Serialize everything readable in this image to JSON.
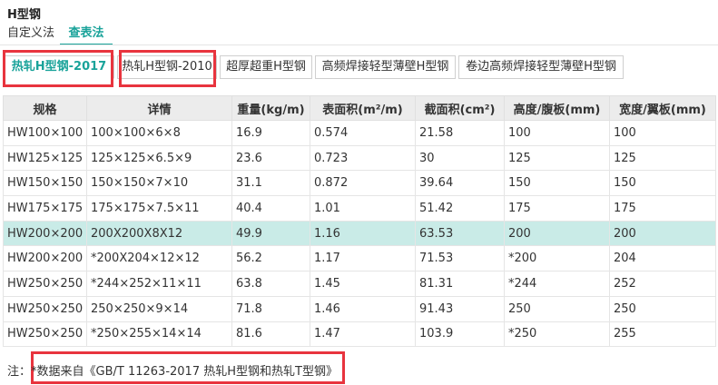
{
  "title": "H型钢",
  "mode_tabs": {
    "custom": "自定义法",
    "lookup": "查表法"
  },
  "standard_tabs": [
    "热轧H型钢-2017",
    "热轧H型钢-2010",
    "超厚超重H型钢",
    "高频焊接轻型薄壁H型钢",
    "卷边高频焊接轻型薄壁H型钢"
  ],
  "table": {
    "headers": [
      "规格",
      "详情",
      "重量(kg/m)",
      "表面积(m²/m)",
      "截面积(cm²)",
      "高度/腹板(mm)",
      "宽度/翼板(mm)"
    ],
    "rows": [
      [
        "HW100×100",
        "100×100×6×8",
        "16.9",
        "0.574",
        "21.58",
        "100",
        "100"
      ],
      [
        "HW125×125",
        "125×125×6.5×9",
        "23.6",
        "0.723",
        "30",
        "125",
        "125"
      ],
      [
        "HW150×150",
        "150×150×7×10",
        "31.1",
        "0.872",
        "39.64",
        "150",
        "150"
      ],
      [
        "HW175×175",
        "175×175×7.5×11",
        "40.4",
        "1.01",
        "51.42",
        "175",
        "175"
      ],
      [
        "HW200×200",
        "200X200X8X12",
        "49.9",
        "1.16",
        "63.53",
        "200",
        "200"
      ],
      [
        "HW200×200",
        "*200X204×12×12",
        "56.2",
        "1.17",
        "71.53",
        "*200",
        "204"
      ],
      [
        "HW250×250",
        "*244×252×11×11",
        "63.8",
        "1.45",
        "81.31",
        "*244",
        "252"
      ],
      [
        "HW250×250",
        "250×250×9×14",
        "71.8",
        "1.46",
        "91.43",
        "250",
        "250"
      ],
      [
        "HW250×250",
        "*250×255×14×14",
        "81.6",
        "1.47",
        "103.9",
        "*250",
        "255"
      ]
    ]
  },
  "note": {
    "label": "注：",
    "text": "*数据来自《GB/T 11263-2017 热轧H型钢和热轧T型钢》"
  },
  "colors": {
    "accent": "#1aa39a",
    "selected_row": "#c9ebe7",
    "highlight_box": "#e8343e"
  }
}
